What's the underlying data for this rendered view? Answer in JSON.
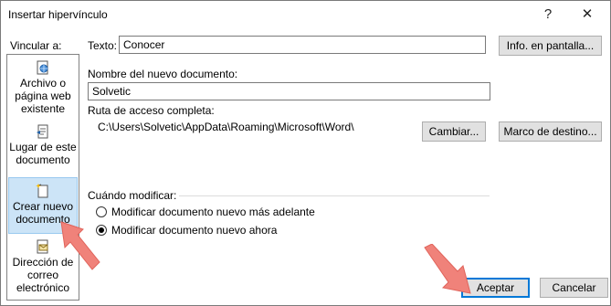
{
  "window": {
    "title": "Insertar hipervínculo",
    "help_glyph": "?",
    "close_glyph": "✕"
  },
  "sidebar": {
    "label": "Vincular a:",
    "items": [
      {
        "label": "Archivo o página web existente",
        "icon": "web-page-icon"
      },
      {
        "label": "Lugar de este documento",
        "icon": "document-place-icon"
      },
      {
        "label": "Crear nuevo documento",
        "icon": "new-document-icon",
        "selected": true
      },
      {
        "label": "Dirección de correo electrónico",
        "icon": "email-icon"
      }
    ]
  },
  "text_field": {
    "label": "Texto:",
    "value": "Conocer"
  },
  "screen_tip_button": "Info. en pantalla...",
  "new_doc": {
    "label": "Nombre del nuevo documento:",
    "value": "Solvetic"
  },
  "full_path": {
    "label": "Ruta de acceso completa:",
    "value": "C:\\Users\\Solvetic\\AppData\\Roaming\\Microsoft\\Word\\"
  },
  "change_button": "Cambiar...",
  "target_frame_button": "Marco de destino...",
  "when_edit": {
    "label": "Cuándo modificar:",
    "options": [
      {
        "label": "Modificar documento nuevo más adelante",
        "checked": false
      },
      {
        "label": "Modificar documento nuevo ahora",
        "checked": true
      }
    ]
  },
  "ok_button": "Aceptar",
  "cancel_button": "Cancelar",
  "colors": {
    "accent": "#0078d7",
    "selected_bg": "#cce4f7",
    "arrow": "#f0827a"
  }
}
